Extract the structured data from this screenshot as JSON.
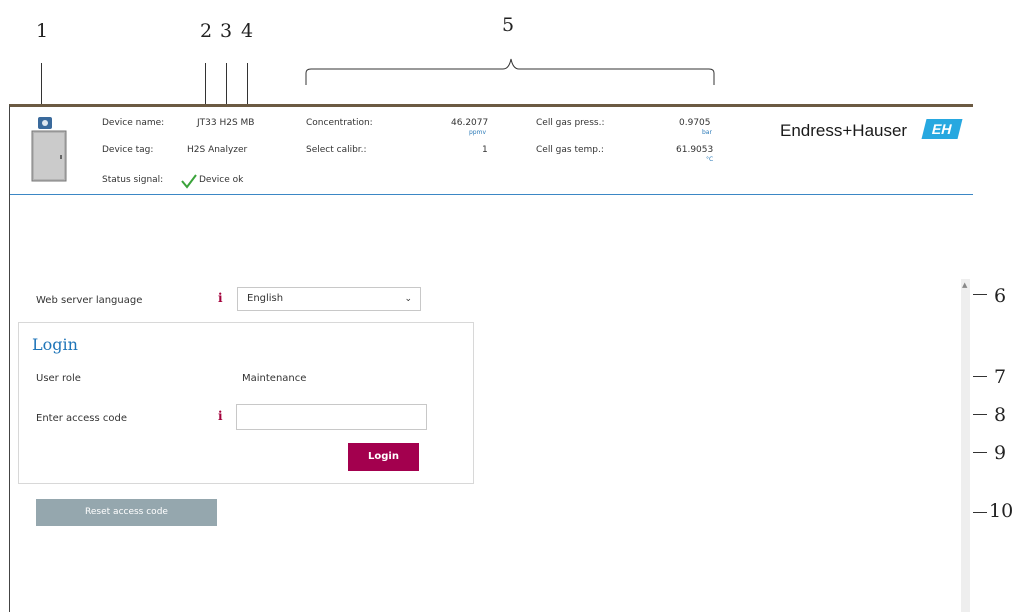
{
  "callouts": [
    "1",
    "2",
    "3",
    "4",
    "5",
    "6",
    "7",
    "8",
    "9",
    "10"
  ],
  "header": {
    "device_name_label": "Device name:",
    "device_name_value": "JT33 H2S MB",
    "device_tag_label": "Device tag:",
    "device_tag_value": "H2S Analyzer",
    "status_signal_label": "Status signal:",
    "status_signal_value": "Device ok",
    "concentration_label": "Concentration:",
    "concentration_value": "46.2077",
    "concentration_unit": "ppmv",
    "select_calibr_label": "Select calibr.:",
    "select_calibr_value": "1",
    "cell_gas_press_label": "Cell gas press.:",
    "cell_gas_press_value": "0.9705",
    "cell_gas_press_unit": "bar",
    "cell_gas_temp_label": "Cell gas temp.:",
    "cell_gas_temp_value": "61.9053",
    "cell_gas_temp_unit": "°C",
    "brand": "Endress+Hauser",
    "brand_logo": "EH"
  },
  "language": {
    "label": "Web server language",
    "selected": "English"
  },
  "login": {
    "title": "Login",
    "user_role_label": "User role",
    "user_role_value": "Maintenance",
    "access_code_label": "Enter access code",
    "access_code_value": "",
    "button": "Login"
  },
  "reset_button": "Reset access code",
  "icons": {
    "info": "info-icon",
    "check": "check-icon",
    "device": "device-icon",
    "chevron": "chevron-down-icon"
  },
  "colors": {
    "accent_blue": "#1f75b8",
    "login_button": "#a3004e",
    "reset_button": "#95a7ae",
    "check_green": "#3aa33a",
    "brand_logo": "#27a8e0"
  }
}
